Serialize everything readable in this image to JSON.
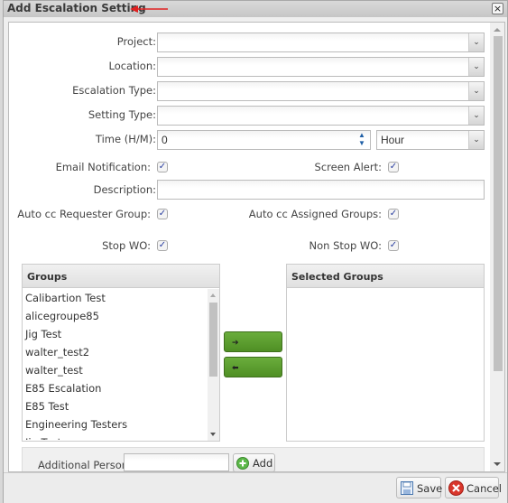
{
  "dialog": {
    "title": "Add Escalation Setting",
    "close_label": "×"
  },
  "form": {
    "project": {
      "label": "Project:",
      "value": ""
    },
    "location": {
      "label": "Location:",
      "value": ""
    },
    "escalation_type": {
      "label": "Escalation Type:",
      "value": ""
    },
    "setting_type": {
      "label": "Setting Type:",
      "value": ""
    },
    "time": {
      "label": "Time (H/M):",
      "value": "0",
      "unit": "Hour"
    },
    "email_notification": {
      "label": "Email Notification:",
      "checked": true
    },
    "screen_alert": {
      "label": "Screen Alert:",
      "checked": true
    },
    "description": {
      "label": "Description:",
      "value": ""
    },
    "auto_cc_requester": {
      "label": "Auto cc Requester Group:",
      "checked": true
    },
    "auto_cc_assigned": {
      "label": "Auto cc Assigned Groups:",
      "checked": true
    },
    "stop_wo": {
      "label": "Stop WO:",
      "checked": true
    },
    "non_stop_wo": {
      "label": "Non Stop WO:",
      "checked": true
    },
    "check_glyph": "✓",
    "drop_glyph": "⌄"
  },
  "groups": {
    "header": "Groups",
    "items": [
      "Calibartion Test",
      "alicegroupe85",
      "Jig Test",
      "walter_test2",
      "walter_test",
      "E85 Escalation",
      "E85 Test",
      "Engineering Testers",
      "Jig Test"
    ]
  },
  "selected_groups": {
    "header": "Selected Groups",
    "items": []
  },
  "move": {
    "add_glyph": "➔",
    "remove_glyph": "⬅"
  },
  "additional_person": {
    "label": "Additional Person:",
    "value": "",
    "add_label": "Add"
  },
  "footer": {
    "save_label": "Save",
    "cancel_label": "Cancel"
  },
  "colors": {
    "accent_green": "#5a9b2e",
    "arrow_annotation": "#e02020"
  }
}
